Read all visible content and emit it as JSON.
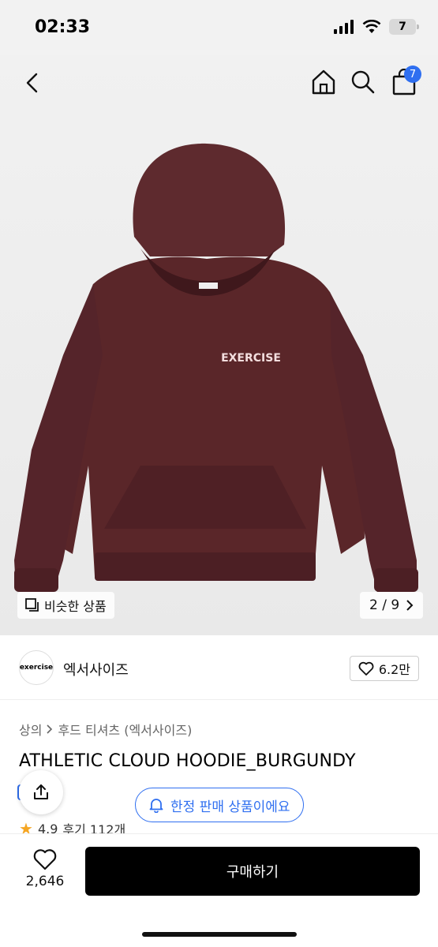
{
  "status_bar": {
    "time": "02:33",
    "battery": "7"
  },
  "nav": {
    "cart_count": "7"
  },
  "image": {
    "similar_label": "비슷한 상품",
    "counter": "2 / 9"
  },
  "brand": {
    "logo_text": "exercise",
    "name": "엑서사이즈",
    "likes": "6.2만"
  },
  "breadcrumb": {
    "category": "상의",
    "subcategory": "후드 티셔츠 (엑서사이즈)"
  },
  "product": {
    "title": "ATHLETIC CLOUD HOODIE_BURGUNDY",
    "limited_label": "한정 판매 상품이에요",
    "rating": "4.9",
    "reviews": "후기 112개"
  },
  "bottom": {
    "wish_count": "2,646",
    "buy_label": "구매하기"
  },
  "colors": {
    "accent": "#2f6ff0",
    "hoodie": "#5e2a2e",
    "buy_button": "#000000"
  }
}
